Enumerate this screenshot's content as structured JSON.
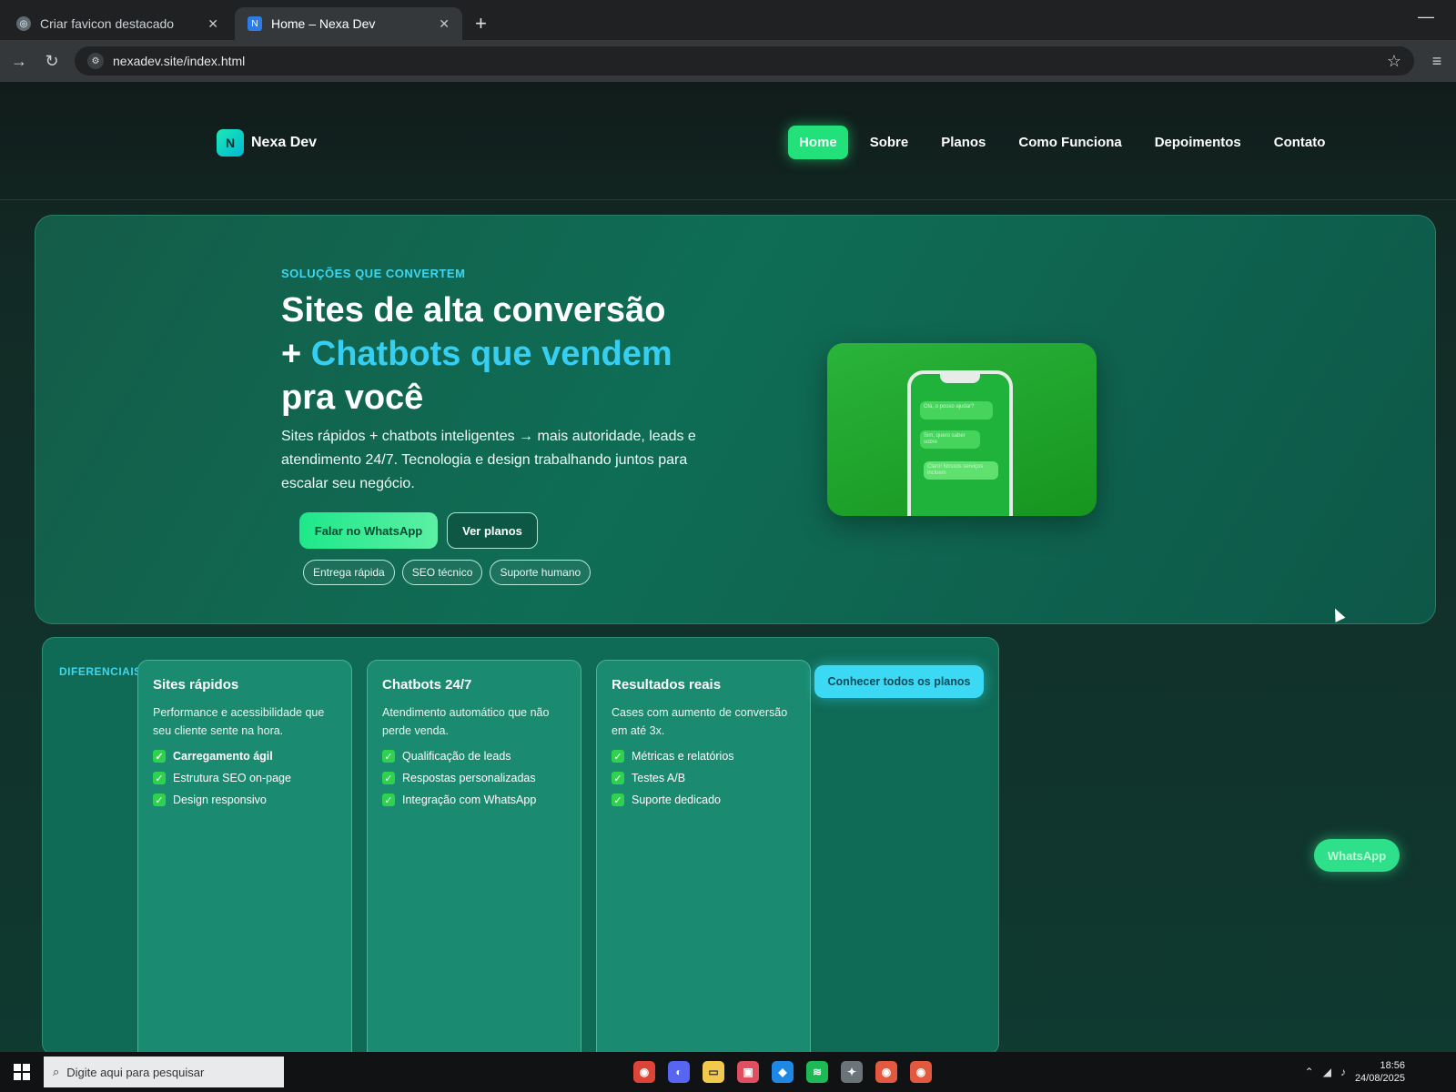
{
  "browser": {
    "tabs": [
      {
        "title": "Criar favicon destacado",
        "active": false
      },
      {
        "title": "Home – Nexa Dev",
        "active": true
      }
    ],
    "new_tab_symbol": "+",
    "url": "nexadev.site/index.html"
  },
  "site": {
    "brand": {
      "mark": "N",
      "name": "Nexa Dev"
    },
    "nav": [
      "Home",
      "Sobre",
      "Planos",
      "Como Funciona",
      "Depoimentos",
      "Contato"
    ],
    "hero": {
      "eyebrow": "SOLUÇÕES QUE CONVERTEM",
      "title_line1": "Sites de alta conversão",
      "title_plus": "+ ",
      "title_accent": "Chatbots que vendem",
      "title_line3": "pra você",
      "lead": "Sites rápidos + chatbots inteligentes → mais autoridade, leads e atendimento 24/7. Tecnologia e design trabalhando juntos para escalar seu negócio.",
      "cta_primary": "Falar no WhatsApp",
      "cta_secondary": "Ver planos",
      "chips": [
        "Entrega rápida",
        "SEO técnico",
        "Suporte humano"
      ],
      "phone_bubbles": [
        "Olá, o posso ajudar?",
        "Sim, quero saber sobre",
        "Claro! Nossos serviços incluem"
      ]
    },
    "differentials": {
      "label": "DIFERENCIAIS",
      "cards": [
        {
          "title": "Sites rápidos",
          "desc": "Performance e acessibilidade que seu cliente sente na hora.",
          "features": [
            "Carregamento ágil",
            "Estrutura SEO on-page",
            "Design responsivo"
          ]
        },
        {
          "title": "Chatbots 24/7",
          "desc": "Atendimento automático que não perde venda.",
          "features": [
            "Qualificação de leads",
            "Respostas personalizadas",
            "Integração com WhatsApp"
          ]
        },
        {
          "title": "Resultados reais",
          "desc": "Cases com aumento de conversão em até 3x.",
          "features": [
            "Métricas e relatórios",
            "Testes A/B",
            "Suporte dedicado"
          ]
        }
      ],
      "cta": "Conhecer todos os planos"
    },
    "floating_whatsapp": "WhatsApp"
  },
  "taskbar": {
    "search_placeholder": "Digite aqui para pesquisar",
    "clock_time": "18:56",
    "clock_date": "24/08/2025"
  }
}
